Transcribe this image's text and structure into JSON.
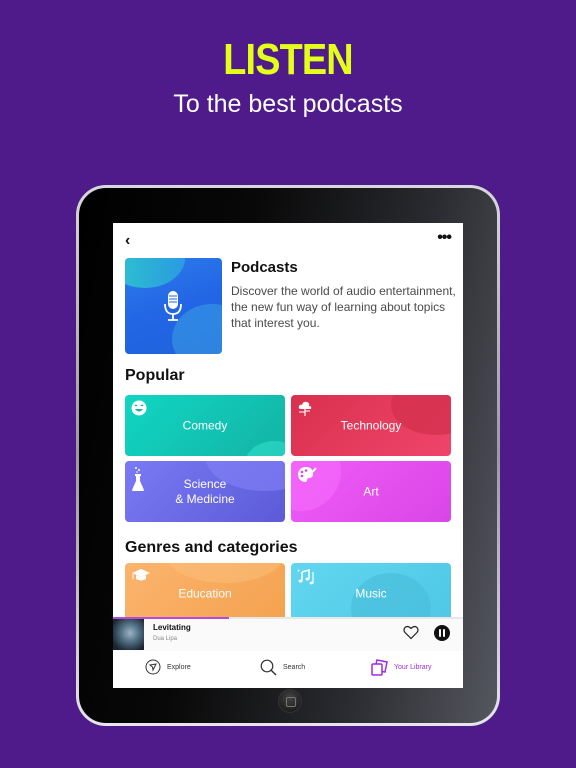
{
  "hero": {
    "title": "LISTEN",
    "subtitle": "To the best podcasts"
  },
  "colors": {
    "background": "#4f1a8a",
    "hero_title": "#e4ff1a",
    "accent": "#9b2de0"
  },
  "header": {
    "back_icon": "chevron-left-icon",
    "more_icon": "ellipsis-icon",
    "back_glyph": "‹",
    "more_glyph": "•••"
  },
  "podcasts": {
    "title": "Podcasts",
    "description": "Discover the world of audio entertainment, the new fun way of learning about topics that interest you.",
    "cover_icon": "microphone-icon"
  },
  "popular": {
    "heading": "Popular",
    "tiles": [
      {
        "label": "Comedy",
        "icon": "laughing-face-icon",
        "color": "#19c8b6"
      },
      {
        "label": "Technology",
        "icon": "cloud-network-icon",
        "color": "#e0375a"
      },
      {
        "label": "Science\n& Medicine",
        "line1": "Science",
        "line2": "& Medicine",
        "icon": "flask-icon",
        "color": "#6c6ae8"
      },
      {
        "label": "Art",
        "icon": "palette-icon",
        "color": "#e552ee"
      }
    ]
  },
  "genres": {
    "heading": "Genres and categories",
    "tiles": [
      {
        "label": "Education",
        "icon": "graduation-cap-icon",
        "color": "#f6a95a"
      },
      {
        "label": "Music",
        "icon": "music-notes-icon",
        "color": "#58d0ec"
      }
    ]
  },
  "player": {
    "song": "Levitating",
    "artist": "Dua Lipa",
    "progress_percent": 33,
    "liked": false,
    "state": "playing"
  },
  "tabbar": {
    "items": [
      {
        "label": "Explore",
        "icon": "compass-icon",
        "active": false
      },
      {
        "label": "Search",
        "icon": "search-icon",
        "active": false
      },
      {
        "label": "Your Library",
        "icon": "library-icon",
        "active": true
      }
    ]
  }
}
